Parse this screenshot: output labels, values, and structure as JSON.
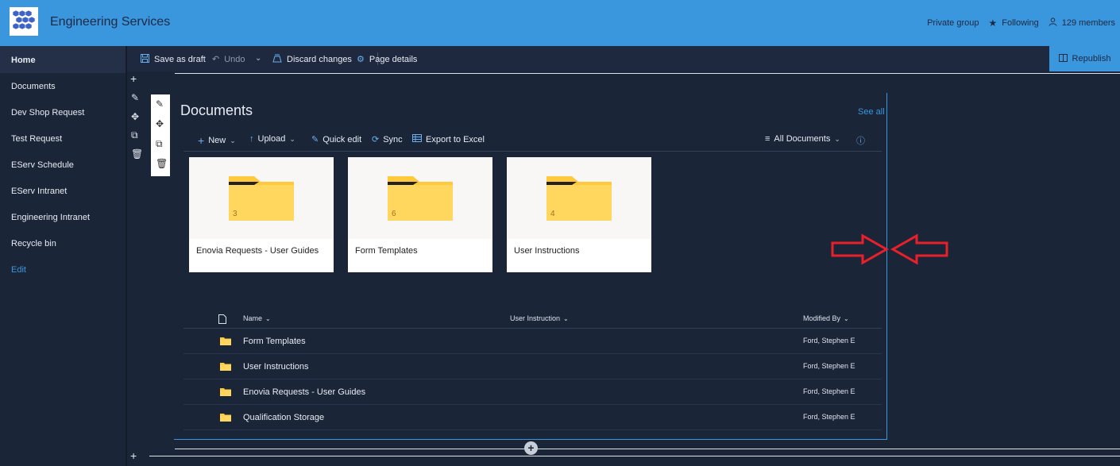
{
  "header": {
    "site_title": "Engineering Services",
    "group_type": "Private group",
    "following_label": "Following",
    "members_label": "129 members",
    "icons": {
      "logo": "hexagon-logo-icon",
      "following": "star-icon",
      "members": "person-icon"
    }
  },
  "leftnav": {
    "items": [
      {
        "label": "Home",
        "active": true
      },
      {
        "label": "Documents"
      },
      {
        "label": "Dev Shop Request"
      },
      {
        "label": "Test Request"
      },
      {
        "label": "EServ Schedule"
      },
      {
        "label": "EServ Intranet"
      },
      {
        "label": "Engineering Intranet"
      },
      {
        "label": "Recycle bin"
      }
    ],
    "edit_label": "Edit"
  },
  "commandbar": {
    "save_draft": "Save as draft",
    "undo": "Undo",
    "discard": "Discard changes",
    "page_details": "Page details",
    "republish": "Republish"
  },
  "webpart": {
    "title": "Documents",
    "see_all": "See all",
    "commands": {
      "new": "New",
      "upload": "Upload",
      "quick_edit": "Quick edit",
      "sync": "Sync",
      "export": "Export to Excel",
      "view": "All Documents"
    },
    "tiles": [
      {
        "name": "Enovia Requests - User Guides",
        "count": "3"
      },
      {
        "name": "Form Templates",
        "count": "6"
      },
      {
        "name": "User Instructions",
        "count": "4"
      }
    ],
    "list": {
      "columns": {
        "name": "Name",
        "user_instruction": "User Instruction",
        "modified_by": "Modified By"
      },
      "rows": [
        {
          "name": "Form Templates",
          "modified_by": "Ford, Stephen E"
        },
        {
          "name": "User Instructions",
          "modified_by": "Ford, Stephen E"
        },
        {
          "name": "Enovia Requests - User Guides",
          "modified_by": "Ford, Stephen E"
        },
        {
          "name": "Qualification Storage",
          "modified_by": "Ford, Stephen E"
        }
      ]
    }
  },
  "colors": {
    "accent": "#3a96dd",
    "background": "#1b2538",
    "folder": "#ffd75e",
    "annotation": "#e8202a"
  }
}
